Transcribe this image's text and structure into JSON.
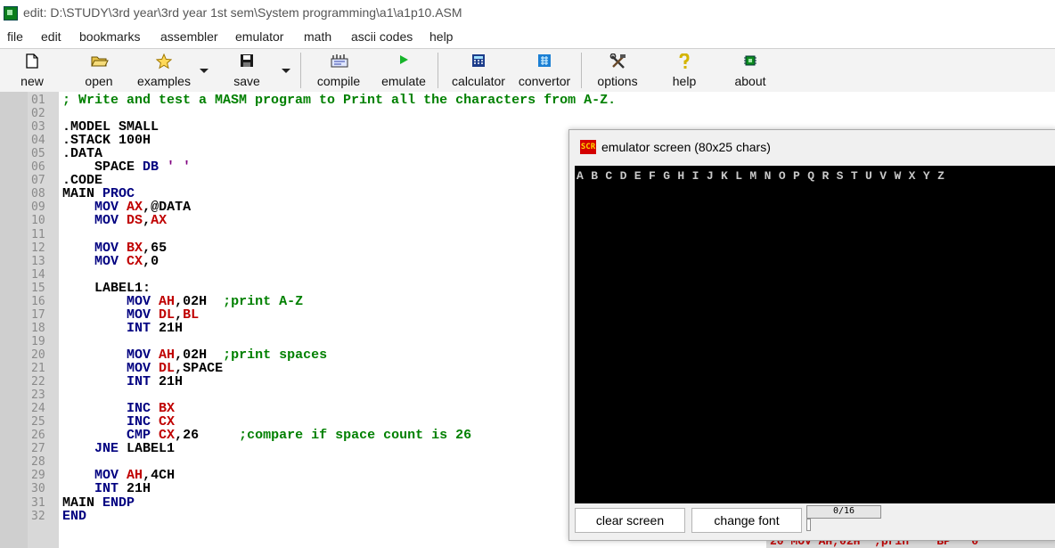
{
  "window": {
    "title": "edit: D:\\STUDY\\3rd year\\3rd year 1st sem\\System programming\\a1\\a1p10.ASM"
  },
  "menu": [
    "file",
    "edit",
    "bookmarks",
    "assembler",
    "emulator",
    "math",
    "ascii codes",
    "help"
  ],
  "toolbar": {
    "new": "new",
    "open": "open",
    "examples": "examples",
    "save": "save",
    "compile": "compile",
    "emulate": "emulate",
    "calculator": "calculator",
    "convertor": "convertor",
    "options": "options",
    "help": "help",
    "about": "about"
  },
  "editor": {
    "line_numbers": [
      "01",
      "02",
      "03",
      "04",
      "05",
      "06",
      "07",
      "08",
      "09",
      "10",
      "11",
      "12",
      "13",
      "14",
      "15",
      "16",
      "17",
      "18",
      "19",
      "20",
      "21",
      "22",
      "23",
      "24",
      "25",
      "26",
      "27",
      "28",
      "29",
      "30",
      "31",
      "32"
    ],
    "lines": [
      [
        {
          "t": "; Write and test a MASM program to Print all the characters from A-Z.",
          "c": "cm"
        }
      ],
      [],
      [
        {
          "t": ".MODEL SMALL",
          "c": "tx"
        }
      ],
      [
        {
          "t": ".STACK 100H",
          "c": "tx"
        }
      ],
      [
        {
          "t": ".DATA",
          "c": "tx"
        }
      ],
      [
        {
          "t": "    SPACE ",
          "c": "tx"
        },
        {
          "t": "DB",
          "c": "kw"
        },
        {
          "t": " ' '",
          "c": "st"
        }
      ],
      [
        {
          "t": ".CODE",
          "c": "tx"
        }
      ],
      [
        {
          "t": "MAIN ",
          "c": "tx"
        },
        {
          "t": "PROC",
          "c": "kw"
        }
      ],
      [
        {
          "t": "    ",
          "c": "tx"
        },
        {
          "t": "MOV",
          "c": "kw"
        },
        {
          "t": " ",
          "c": "tx"
        },
        {
          "t": "AX",
          "c": "rg"
        },
        {
          "t": ",@DATA",
          "c": "tx"
        }
      ],
      [
        {
          "t": "    ",
          "c": "tx"
        },
        {
          "t": "MOV",
          "c": "kw"
        },
        {
          "t": " ",
          "c": "tx"
        },
        {
          "t": "DS",
          "c": "rg"
        },
        {
          "t": ",",
          "c": "tx"
        },
        {
          "t": "AX",
          "c": "rg"
        }
      ],
      [],
      [
        {
          "t": "    ",
          "c": "tx"
        },
        {
          "t": "MOV",
          "c": "kw"
        },
        {
          "t": " ",
          "c": "tx"
        },
        {
          "t": "BX",
          "c": "rg"
        },
        {
          "t": ",65",
          "c": "tx"
        }
      ],
      [
        {
          "t": "    ",
          "c": "tx"
        },
        {
          "t": "MOV",
          "c": "kw"
        },
        {
          "t": " ",
          "c": "tx"
        },
        {
          "t": "CX",
          "c": "rg"
        },
        {
          "t": ",0",
          "c": "tx"
        }
      ],
      [],
      [
        {
          "t": "    LABEL1:",
          "c": "tx"
        }
      ],
      [
        {
          "t": "        ",
          "c": "tx"
        },
        {
          "t": "MOV",
          "c": "kw"
        },
        {
          "t": " ",
          "c": "tx"
        },
        {
          "t": "AH",
          "c": "rg"
        },
        {
          "t": ",02H  ",
          "c": "tx"
        },
        {
          "t": ";print A-Z",
          "c": "cm"
        }
      ],
      [
        {
          "t": "        ",
          "c": "tx"
        },
        {
          "t": "MOV",
          "c": "kw"
        },
        {
          "t": " ",
          "c": "tx"
        },
        {
          "t": "DL",
          "c": "rg"
        },
        {
          "t": ",",
          "c": "tx"
        },
        {
          "t": "BL",
          "c": "rg"
        }
      ],
      [
        {
          "t": "        ",
          "c": "tx"
        },
        {
          "t": "INT",
          "c": "kw"
        },
        {
          "t": " 21H",
          "c": "tx"
        }
      ],
      [],
      [
        {
          "t": "        ",
          "c": "tx"
        },
        {
          "t": "MOV",
          "c": "kw"
        },
        {
          "t": " ",
          "c": "tx"
        },
        {
          "t": "AH",
          "c": "rg"
        },
        {
          "t": ",02H  ",
          "c": "tx"
        },
        {
          "t": ";print spaces",
          "c": "cm"
        }
      ],
      [
        {
          "t": "        ",
          "c": "tx"
        },
        {
          "t": "MOV",
          "c": "kw"
        },
        {
          "t": " ",
          "c": "tx"
        },
        {
          "t": "DL",
          "c": "rg"
        },
        {
          "t": ",SPACE",
          "c": "tx"
        }
      ],
      [
        {
          "t": "        ",
          "c": "tx"
        },
        {
          "t": "INT",
          "c": "kw"
        },
        {
          "t": " 21H",
          "c": "tx"
        }
      ],
      [],
      [
        {
          "t": "        ",
          "c": "tx"
        },
        {
          "t": "INC",
          "c": "kw"
        },
        {
          "t": " ",
          "c": "tx"
        },
        {
          "t": "BX",
          "c": "rg"
        }
      ],
      [
        {
          "t": "        ",
          "c": "tx"
        },
        {
          "t": "INC",
          "c": "kw"
        },
        {
          "t": " ",
          "c": "tx"
        },
        {
          "t": "CX",
          "c": "rg"
        }
      ],
      [
        {
          "t": "        ",
          "c": "tx"
        },
        {
          "t": "CMP",
          "c": "kw"
        },
        {
          "t": " ",
          "c": "tx"
        },
        {
          "t": "CX",
          "c": "rg"
        },
        {
          "t": ",26     ",
          "c": "tx"
        },
        {
          "t": ";compare if space count is 26",
          "c": "cm"
        }
      ],
      [
        {
          "t": "    ",
          "c": "tx"
        },
        {
          "t": "JNE",
          "c": "kw"
        },
        {
          "t": " LABEL1",
          "c": "tx"
        }
      ],
      [],
      [
        {
          "t": "    ",
          "c": "tx"
        },
        {
          "t": "MOV",
          "c": "kw"
        },
        {
          "t": " ",
          "c": "tx"
        },
        {
          "t": "AH",
          "c": "rg"
        },
        {
          "t": ",4CH",
          "c": "tx"
        }
      ],
      [
        {
          "t": "    ",
          "c": "tx"
        },
        {
          "t": "INT",
          "c": "kw"
        },
        {
          "t": " 21H",
          "c": "tx"
        }
      ],
      [
        {
          "t": "MAIN ",
          "c": "tx"
        },
        {
          "t": "ENDP",
          "c": "kw"
        }
      ],
      [
        {
          "t": "END",
          "c": "kw"
        }
      ]
    ]
  },
  "emulator_screen": {
    "title": "emulator screen (80x25 chars)",
    "icon_text": "SCR",
    "output": "A B C D E F G H I J K L M N O P Q R S T U V W X Y Z",
    "clear_label": "clear screen",
    "font_label": "change font",
    "counter": "0/16"
  },
  "background_fragment": "20 MOV AH,02H  ;prin    BP   0"
}
